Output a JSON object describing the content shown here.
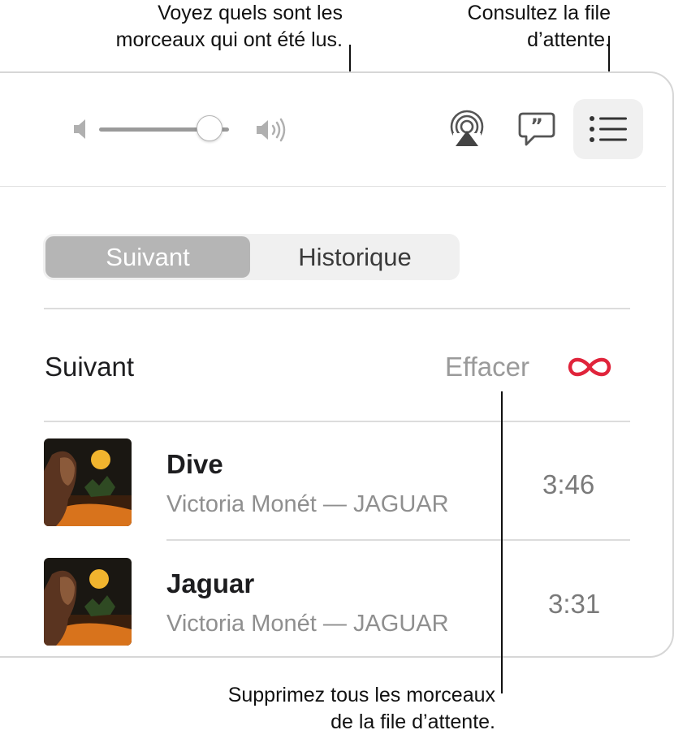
{
  "callouts": {
    "history": [
      "Voyez quels sont les",
      "morceaux qui ont été lus."
    ],
    "queue": [
      "Consultez la file",
      "d’attente."
    ],
    "clear": [
      "Supprimez tous les morceaux",
      "de la file d’attente."
    ]
  },
  "toolbar": {
    "volume_level": 0.85,
    "buttons": [
      "airplay-icon",
      "lyrics-icon",
      "queue-list-icon"
    ]
  },
  "segmented": {
    "options": [
      "Suivant",
      "Historique"
    ],
    "selected": "Suivant"
  },
  "queue": {
    "title": "Suivant",
    "clear_label": "Effacer",
    "autoplay_icon": "infinity-icon",
    "accent_color": "#e0243b",
    "tracks": [
      {
        "title": "Dive",
        "subtitle": "Victoria Monét — JAGUAR",
        "duration": "3:46"
      },
      {
        "title": "Jaguar",
        "subtitle": "Victoria Monét — JAGUAR",
        "duration": "3:31"
      }
    ]
  }
}
